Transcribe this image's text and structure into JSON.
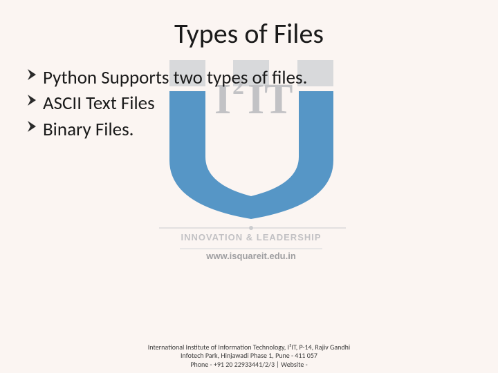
{
  "title": "Types of Files",
  "bullets": [
    "Python Supports two types of files.",
    "ASCII Text Files",
    "Binary Files."
  ],
  "watermark": {
    "top_text": "I",
    "top_sup": "2",
    "top_text2": "IT",
    "tagline": "INNOVATION & LEADERSHIP",
    "url": "www.isquareit.edu.in"
  },
  "footer": {
    "line1": "International Institute of Information Technology, I²IT, P-14, Rajiv Gandhi Infotech Park, Hinjawadi Phase 1, Pune - 411 057",
    "line2": "Phone - +91 20 22933441/2/3 | Website -"
  }
}
